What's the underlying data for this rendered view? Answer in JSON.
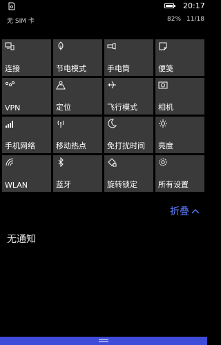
{
  "status_bar": {
    "time": "20:17",
    "battery_level": 0.82,
    "left_icon": "sim-card-icon",
    "battery_icon": "battery-icon"
  },
  "subline": {
    "carrier": "无 SIM 卡",
    "battery_percent": "82%",
    "date": "11/18"
  },
  "tiles": [
    {
      "label": "连接",
      "icon": "connect-icon"
    },
    {
      "label": "节电模式",
      "icon": "battery-saver-icon"
    },
    {
      "label": "手电筒",
      "icon": "flashlight-icon"
    },
    {
      "label": "便笺",
      "icon": "note-icon"
    },
    {
      "label": "VPN",
      "icon": "vpn-icon"
    },
    {
      "label": "定位",
      "icon": "location-icon"
    },
    {
      "label": "飞行模式",
      "icon": "airplane-icon"
    },
    {
      "label": "相机",
      "icon": "camera-icon"
    },
    {
      "label": "手机网络",
      "icon": "cellular-icon"
    },
    {
      "label": "移动热点",
      "icon": "hotspot-icon"
    },
    {
      "label": "免打扰时间",
      "icon": "moon-icon"
    },
    {
      "label": "亮度",
      "icon": "brightness-icon"
    },
    {
      "label": "WLAN",
      "icon": "wifi-icon"
    },
    {
      "label": "蓝牙",
      "icon": "bluetooth-icon"
    },
    {
      "label": "旋转锁定",
      "icon": "rotation-lock-icon"
    },
    {
      "label": "所有设置",
      "icon": "settings-gear-icon"
    }
  ],
  "collapse_label": "折叠",
  "no_notifications": "无通知",
  "accent_color": "#3f4bd9",
  "tile_color": "#3a3a3a"
}
